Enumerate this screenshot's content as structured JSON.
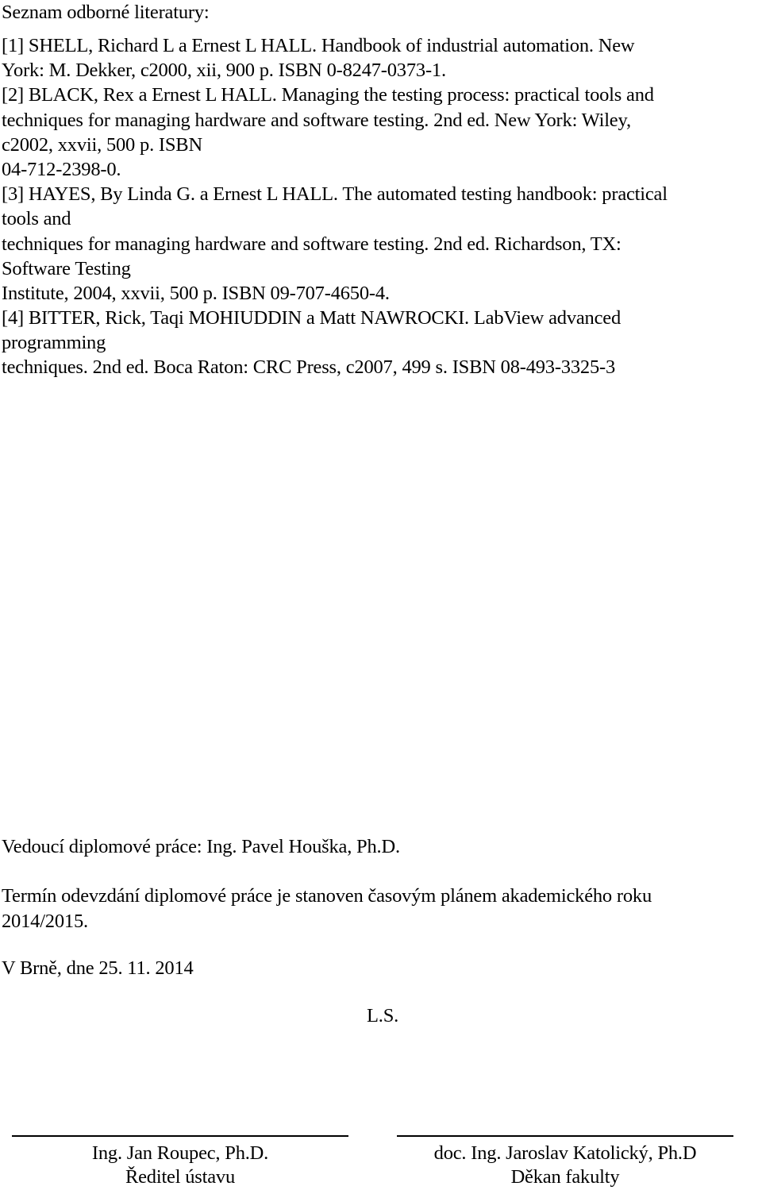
{
  "document": {
    "heading": "Seznam odborné literatury:",
    "references": [
      {
        "lines": [
          "[1] SHELL, Richard L a Ernest L HALL. Handbook of industrial automation. New",
          "York: M. Dekker, c2000, xii, 900 p. ISBN 0-8247-0373-1."
        ]
      },
      {
        "lines": [
          "[2] BLACK, Rex a Ernest L HALL. Managing the testing process: practical tools and",
          "techniques for managing hardware and software testing. 2nd ed. New York: Wiley,",
          "c2002, xxvii, 500 p. ISBN",
          "04-712-2398-0."
        ]
      },
      {
        "lines": [
          "[3] HAYES, By Linda G. a Ernest L HALL. The automated testing handbook: practical",
          "tools and",
          "techniques for managing hardware and software testing. 2nd ed. Richardson, TX:",
          "Software Testing",
          "Institute, 2004, xxvii, 500 p. ISBN 09-707-4650-4."
        ]
      },
      {
        "lines": [
          "[4] BITTER, Rick, Taqi MOHIUDDIN a Matt NAWROCKI. LabView advanced",
          "programming",
          "techniques. 2nd ed. Boca Raton: CRC Press, c2007, 499 s. ISBN 08-493-3325-3"
        ]
      }
    ],
    "supervisor": "Vedoucí diplomové  práce: Ing. Pavel Houška, Ph.D.",
    "deadline_line1": "Termín odevzdání diplomové  práce je stanoven časovým plánem akademického roku",
    "deadline_line2": "2014/2015.",
    "place_date": "V Brně, dne 25. 11. 2014",
    "seal": "L.S.",
    "signatures": [
      {
        "name": "Ing. Jan Roupec, Ph.D.",
        "role": "Ředitel ústavu"
      },
      {
        "name": "doc. Ing. Jaroslav Katolický, Ph.D",
        "role": "Děkan fakulty"
      }
    ]
  }
}
